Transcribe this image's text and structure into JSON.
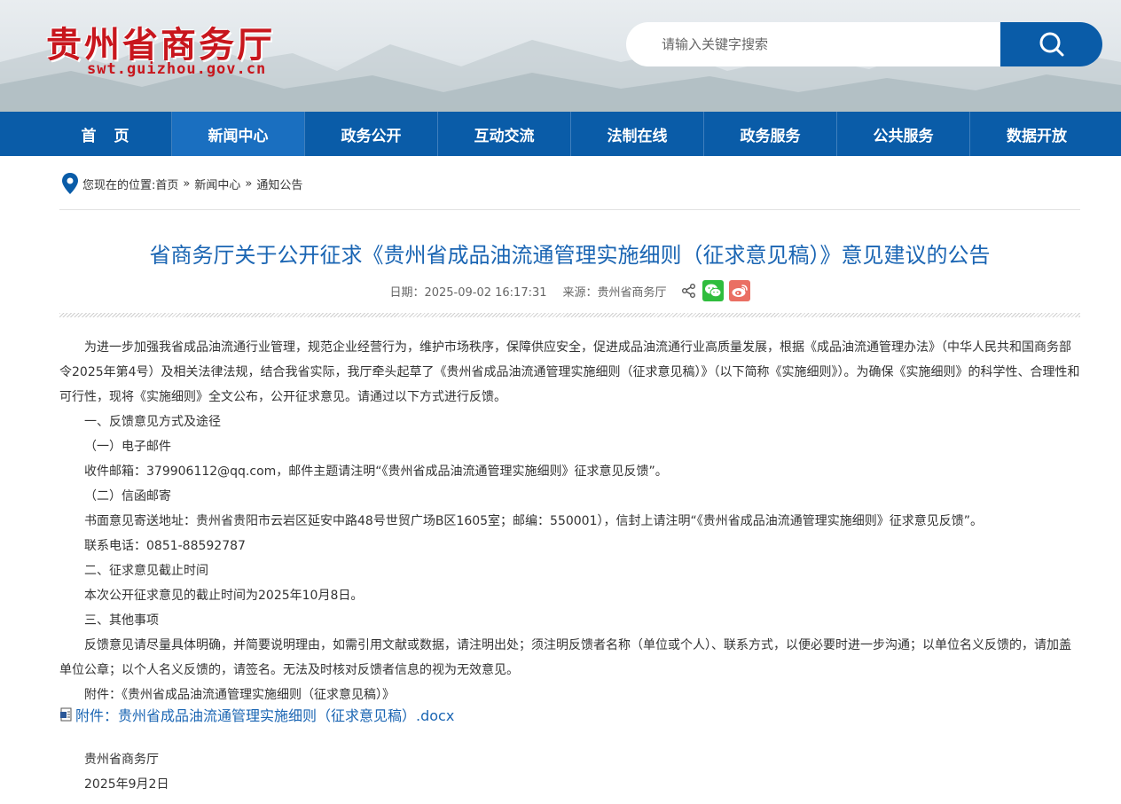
{
  "header": {
    "site_title": "贵州省商务厅",
    "site_url": "swt.guizhou.gov.cn",
    "search": {
      "placeholder": "请输入关键字搜索"
    }
  },
  "nav": {
    "items": [
      {
        "label": "首页"
      },
      {
        "label": "新闻中心",
        "active": true
      },
      {
        "label": "政务公开"
      },
      {
        "label": "互动交流"
      },
      {
        "label": "法制在线"
      },
      {
        "label": "政务服务"
      },
      {
        "label": "公共服务"
      },
      {
        "label": "数据开放"
      }
    ]
  },
  "breadcrumb": {
    "prefix": "您现在的位置:",
    "items": [
      "首页",
      "新闻中心",
      "通知公告"
    ],
    "separator": "»"
  },
  "article": {
    "title": "省商务厅关于公开征求《贵州省成品油流通管理实施细则（征求意见稿）》意见建议的公告",
    "date_label": "日期：",
    "date": "2025-09-02 16:17:31",
    "source_label": "来源：",
    "source": "贵州省商务厅",
    "paragraphs": [
      "为进一步加强我省成品油流通行业管理，规范企业经营行为，维护市场秩序，保障供应安全，促进成品油流通行业高质量发展，根据《成品油流通管理办法》（中华人民共和国商务部令2025年第4号）及相关法律法规，结合我省实际，我厅牵头起草了《贵州省成品油流通管理实施细则（征求意见稿）》（以下简称《实施细则》）。为确保《实施细则》的科学性、合理性和可行性，现将《实施细则》全文公布，公开征求意见。请通过以下方式进行反馈。",
      "一、反馈意见方式及途径",
      "（一）电子邮件",
      "收件邮箱：379906112@qq.com，邮件主题请注明“《贵州省成品油流通管理实施细则》征求意见反馈”。",
      "（二）信函邮寄",
      "书面意见寄送地址：贵州省贵阳市云岩区延安中路48号世贸广场B区1605室；邮编：550001），信封上请注明“《贵州省成品油流通管理实施细则》征求意见反馈”。",
      "联系电话：0851-88592787",
      "二、征求意见截止时间",
      "本次公开征求意见的截止时间为2025年10月8日。",
      "三、其他事项",
      "反馈意见请尽量具体明确，并简要说明理由，如需引用文献或数据，请注明出处；须注明反馈者名称（单位或个人）、联系方式，以便必要时进一步沟通；以单位名义反馈的，请加盖单位公章；以个人名义反馈的，请签名。无法及时核对反馈者信息的视为无效意见。",
      "附件：《贵州省成品油流通管理实施细则（征求意见稿）》"
    ],
    "attachment_link": "附件：贵州省成品油流通管理实施细则（征求意见稿）.docx",
    "signature_org": "贵州省商务厅",
    "signature_date": "2025年9月2日"
  },
  "colors": {
    "brand_blue": "#0a5ca8",
    "title_blue": "#1a65b3",
    "logo_red": "#c8161d",
    "wechat_green": "#2fbd3d",
    "weibo_red": "#ea6f63"
  }
}
